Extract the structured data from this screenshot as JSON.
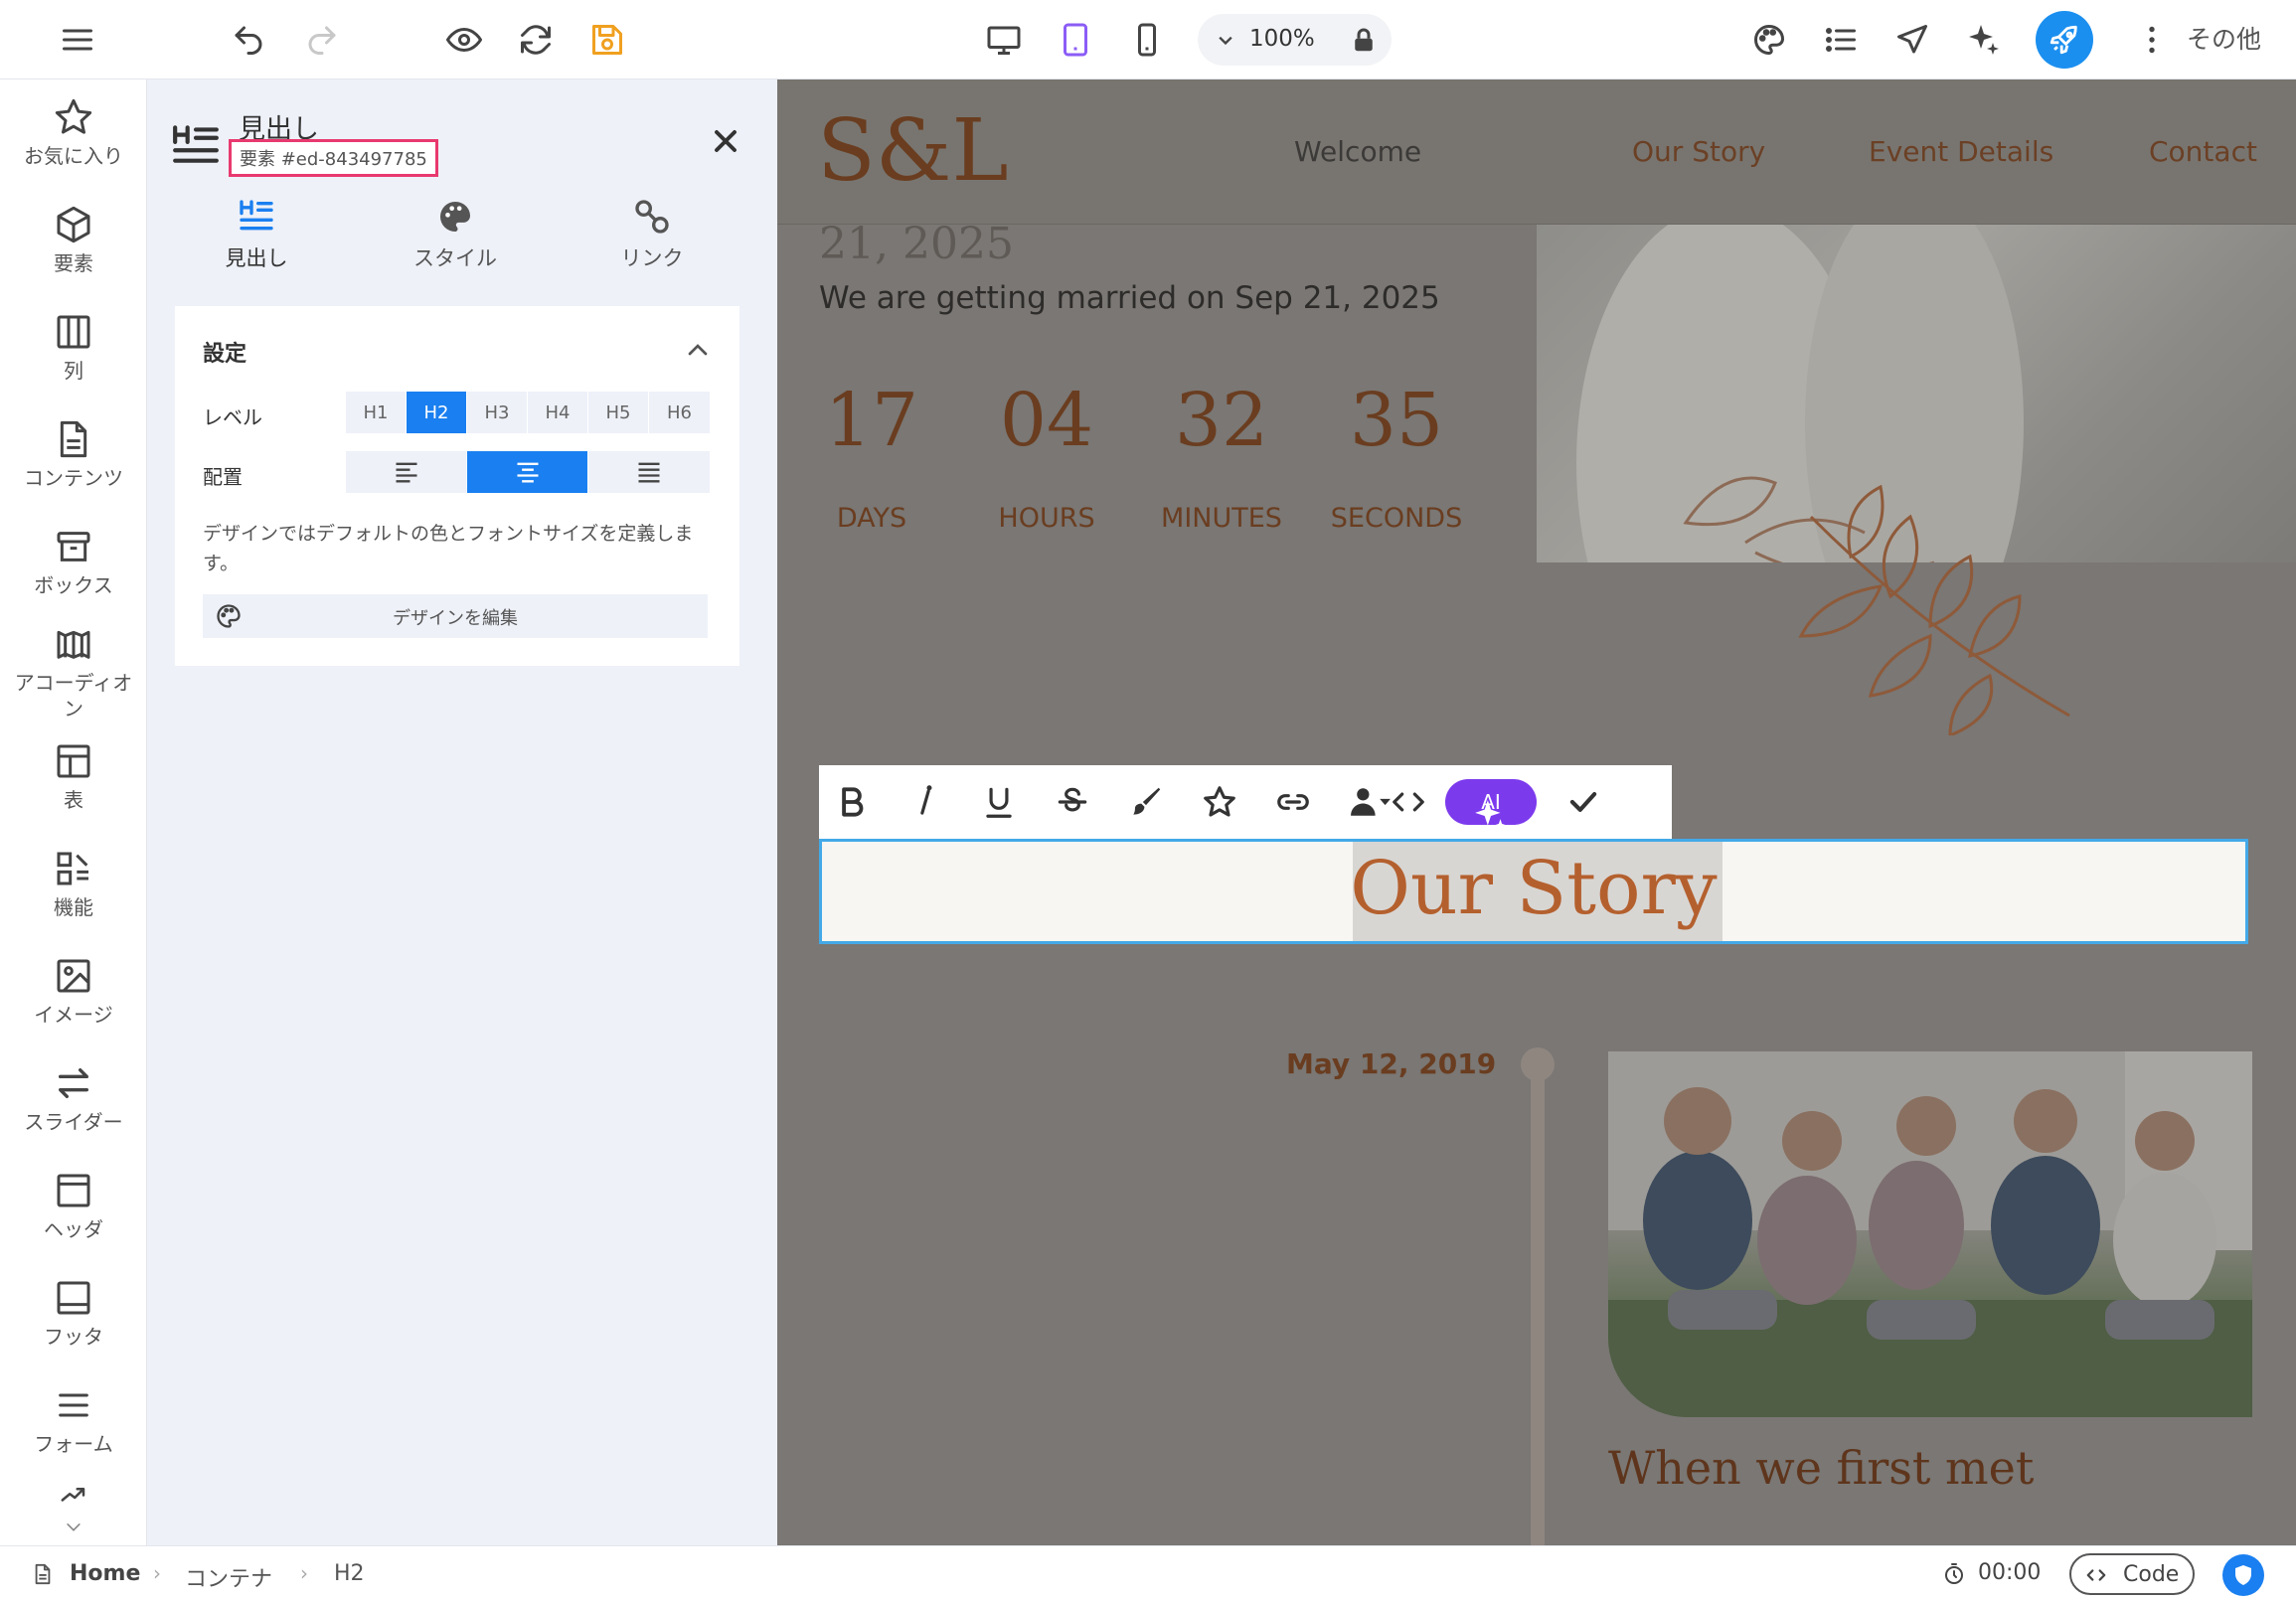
{
  "toolbar": {
    "zoom": "100%",
    "more_label": "その他"
  },
  "rail": {
    "items": [
      {
        "label": "お気に入り",
        "icon": "star-icon"
      },
      {
        "label": "要素",
        "icon": "cube-icon"
      },
      {
        "label": "列",
        "icon": "columns-icon"
      },
      {
        "label": "コンテンツ",
        "icon": "document-icon"
      },
      {
        "label": "ボックス",
        "icon": "box-icon"
      },
      {
        "label": "アコーディオン",
        "icon": "accordion-icon"
      },
      {
        "label": "表",
        "icon": "table-icon"
      },
      {
        "label": "機能",
        "icon": "features-icon"
      },
      {
        "label": "イメージ",
        "icon": "image-icon"
      },
      {
        "label": "スライダー",
        "icon": "slider-icon"
      },
      {
        "label": "ヘッダ",
        "icon": "header-icon"
      },
      {
        "label": "フッタ",
        "icon": "footer-icon"
      },
      {
        "label": "フォーム",
        "icon": "form-icon"
      }
    ]
  },
  "panel": {
    "title": "見出し",
    "element_id": "要素 #ed-843497785",
    "tabs": [
      {
        "label": "見出し",
        "icon": "heading-icon"
      },
      {
        "label": "スタイル",
        "icon": "palette-icon"
      },
      {
        "label": "リンク",
        "icon": "link-icon"
      }
    ],
    "settings": {
      "title": "設定",
      "level_label": "レベル",
      "levels": [
        "H1",
        "H2",
        "H3",
        "H4",
        "H5",
        "H6"
      ],
      "selected_level": "H2",
      "align_label": "配置",
      "selected_align": "center",
      "help_text": "デザインではデフォルトの色とフォントサイズを定義します。",
      "design_button": "デザインを編集"
    }
  },
  "site": {
    "logo": "S&L",
    "nav": [
      "Welcome",
      "Our Story",
      "Event Details",
      "Contact"
    ],
    "date_partial": "21, 2025",
    "married_line": "We are getting married on Sep 21, 2025",
    "countdown": [
      {
        "value": "17",
        "unit": "DAYS"
      },
      {
        "value": "04",
        "unit": "HOURS"
      },
      {
        "value": "32",
        "unit": "MINUTES"
      },
      {
        "value": "35",
        "unit": "SECONDS"
      }
    ],
    "editor_ai_label": "AI",
    "heading": "Our Story",
    "timeline_date": "May 12, 2019",
    "story_title": "When we first met"
  },
  "status": {
    "breadcrumbs": [
      "Home",
      "コンテナ",
      "H2"
    ],
    "timer": "00:00",
    "code_label": "Code"
  },
  "colors": {
    "accent": "#1a7ff0",
    "highlight_frame": "#e8396f",
    "selection_border": "#43a9e8",
    "ai_purple": "#7c3aed",
    "heading_color": "#b4602e"
  }
}
